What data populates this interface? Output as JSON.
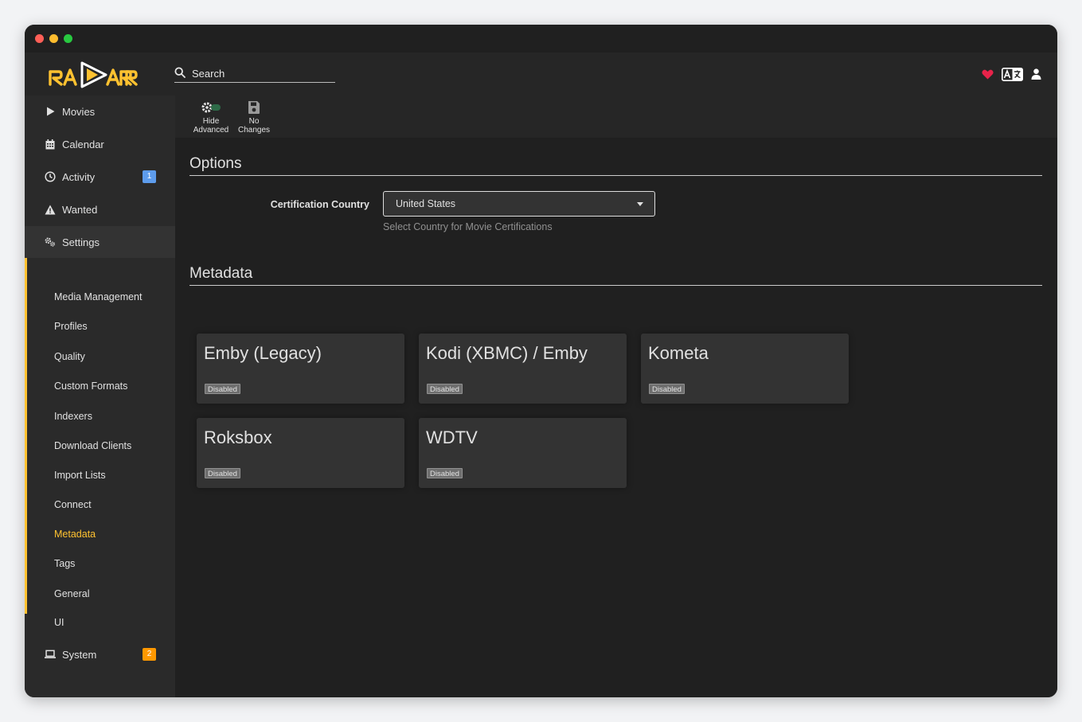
{
  "app": {
    "name": "Radarr"
  },
  "colors": {
    "accent": "#ffc230",
    "activity_badge": "#5d9cec",
    "system_badge": "#ff9900",
    "heart": "#e7234a"
  },
  "header": {
    "search_placeholder": "Search",
    "icons": [
      "heart-icon",
      "translate-icon",
      "user-icon"
    ]
  },
  "sidebar": {
    "items": [
      {
        "label": "Movies",
        "icon": "play-icon"
      },
      {
        "label": "Calendar",
        "icon": "calendar-icon"
      },
      {
        "label": "Activity",
        "icon": "clock-icon",
        "badge": "1"
      },
      {
        "label": "Wanted",
        "icon": "warning-icon"
      },
      {
        "label": "Settings",
        "icon": "gears-icon"
      },
      {
        "label": "System",
        "icon": "laptop-icon",
        "badge": "2"
      }
    ],
    "settings_sub": [
      "Media Management",
      "Profiles",
      "Quality",
      "Custom Formats",
      "Indexers",
      "Download Clients",
      "Import Lists",
      "Connect",
      "Metadata",
      "Tags",
      "General",
      "UI"
    ],
    "active_sub": "Metadata"
  },
  "toolbar": {
    "hide_advanced": [
      "Hide",
      "Advanced"
    ],
    "no_changes": [
      "No",
      "Changes"
    ]
  },
  "options": {
    "title": "Options",
    "certification_label": "Certification Country",
    "certification_value": "United States",
    "certification_help": "Select Country for Movie Certifications"
  },
  "metadata": {
    "title": "Metadata",
    "cards": [
      {
        "name": "Emby (Legacy)",
        "status": "Disabled"
      },
      {
        "name": "Kodi (XBMC) / Emby",
        "status": "Disabled"
      },
      {
        "name": "Kometa",
        "status": "Disabled"
      },
      {
        "name": "Roksbox",
        "status": "Disabled"
      },
      {
        "name": "WDTV",
        "status": "Disabled"
      }
    ]
  }
}
